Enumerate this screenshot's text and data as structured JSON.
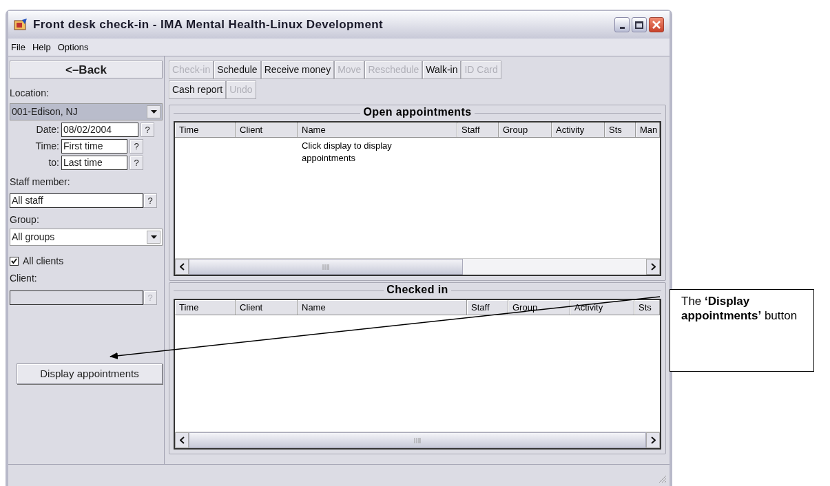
{
  "window": {
    "title": "Front desk check-in - IMA Mental Health-Linux Development"
  },
  "menu": [
    "File",
    "Help",
    "Options"
  ],
  "back_button": "<–Back",
  "toolbar": [
    [
      {
        "label": "Check-in",
        "disabled": true
      },
      {
        "label": "Schedule",
        "disabled": false
      },
      {
        "label": "Receive money",
        "disabled": false
      },
      {
        "label": "Move",
        "disabled": true
      },
      {
        "label": "Reschedule",
        "disabled": true
      },
      {
        "label": "Walk-in",
        "disabled": false
      },
      {
        "label": "ID Card",
        "disabled": true
      }
    ],
    [
      {
        "label": "Cash report",
        "disabled": false
      },
      {
        "label": "Undo",
        "disabled": true
      }
    ]
  ],
  "filters": {
    "location_label": "Location:",
    "location": "001-Edison, NJ",
    "date_label": "Date:",
    "date": "08/02/2004",
    "date_help": "?",
    "time_label": "Time:",
    "time": "First time",
    "time_help": "?",
    "to_label": "to:",
    "to": "Last time",
    "to_help": "?",
    "staff_label": "Staff member:",
    "staff": "All staff",
    "staff_help": "?",
    "group_label": "Group:",
    "group": "All groups",
    "all_clients": {
      "label": "All clients",
      "checked": true
    },
    "client_label": "Client:",
    "client_help": "?",
    "client_disabled": true
  },
  "display_button": "Display appointments",
  "open_appointments": {
    "title": "Open appointments",
    "columns": [
      "Time",
      "Client",
      "Name",
      "Staff",
      "Group",
      "Activity",
      "Sts",
      "Man"
    ],
    "message": "Click display to display appointments"
  },
  "checked_in": {
    "title": "Checked in",
    "columns": [
      "Time",
      "Client",
      "Name",
      "Staff",
      "Group",
      "Activity",
      "Sts"
    ]
  },
  "callout": {
    "text": "The **‘Display appointments’** button"
  }
}
